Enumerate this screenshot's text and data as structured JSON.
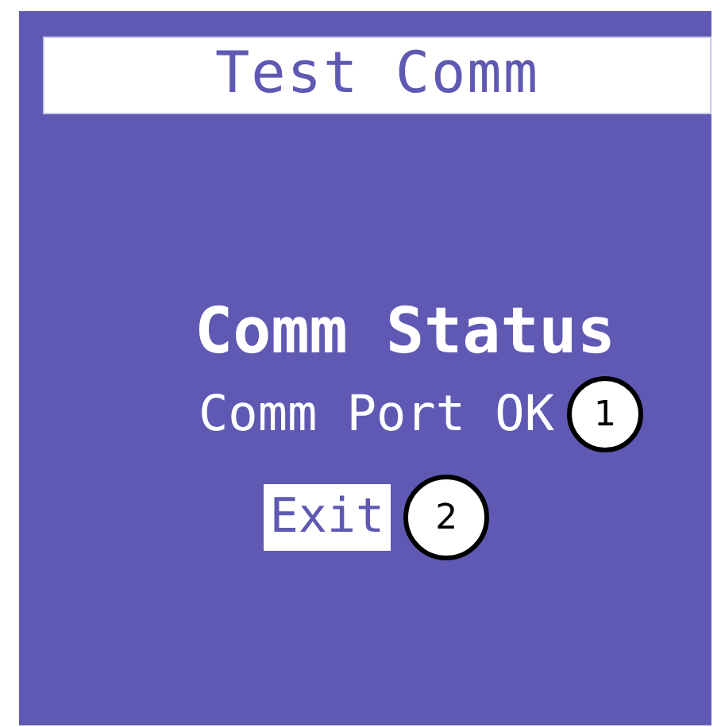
{
  "screen": {
    "title": "Test Comm"
  },
  "status": {
    "heading": "Comm Status",
    "message": "Comm Port OK"
  },
  "exit_button": {
    "label": "Exit"
  },
  "callouts": [
    "1",
    "2"
  ]
}
